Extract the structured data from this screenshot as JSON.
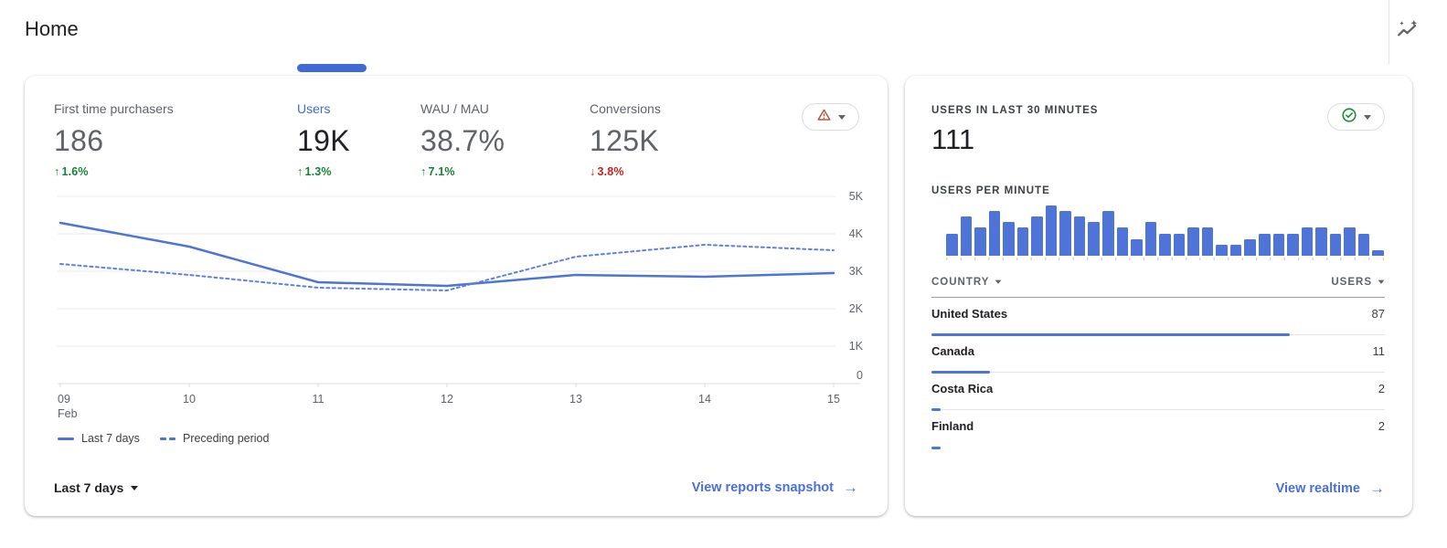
{
  "page": {
    "title": "Home"
  },
  "icons": {
    "arrow_right": "→",
    "arrow_up": "↑",
    "arrow_down": "↓"
  },
  "colors": {
    "chart_blue": "#4f74d8",
    "dashed_blue": "#5e80e0",
    "selected_blue": "#3e6bd6",
    "link_blue": "#4a6fdc",
    "positive_green": "#188038",
    "negative_red": "#c5221f",
    "warning_orange": "#ae5b41",
    "realtime_ok_green": "#1e8e3e"
  },
  "overview_card": {
    "metrics": [
      {
        "label": "First time purchasers",
        "value": "186",
        "delta": "1.6%",
        "direction": "up",
        "selected": false
      },
      {
        "label": "Users",
        "value": "19K",
        "delta": "1.3%",
        "direction": "up",
        "selected": true
      },
      {
        "label": "WAU / MAU",
        "value": "38.7%",
        "delta": "7.1%",
        "direction": "up",
        "selected": false
      },
      {
        "label": "Conversions",
        "value": "125K",
        "delta": "3.8%",
        "direction": "down",
        "selected": false
      }
    ],
    "legend": [
      {
        "label": "Last 7 days",
        "style": "solid"
      },
      {
        "label": "Preceding period",
        "style": "dashed"
      }
    ],
    "date_range_label": "Last 7 days",
    "link_label": "View reports snapshot",
    "chart_data": {
      "type": "line",
      "title": "Users",
      "x": [
        "09 Feb",
        "10",
        "11",
        "12",
        "13",
        "14",
        "15"
      ],
      "series": [
        {
          "name": "Last 7 days",
          "style": "solid",
          "values": [
            4300,
            3650,
            2700,
            2600,
            2900,
            2850,
            2950
          ]
        },
        {
          "name": "Preceding period",
          "style": "dashed",
          "values": [
            3200,
            2900,
            2550,
            2500,
            3400,
            3700,
            3550
          ]
        }
      ],
      "ylim": [
        0,
        5000
      ],
      "yticks": [
        0,
        1000,
        2000,
        3000,
        4000,
        5000
      ],
      "ytick_labels": [
        "0",
        "1K",
        "2K",
        "3K",
        "4K",
        "5K"
      ],
      "grid": true,
      "legend_position": "bottom"
    }
  },
  "realtime_card": {
    "title": "USERS IN LAST 30 MINUTES",
    "value": "111",
    "per_minute_label": "USERS PER MINUTE",
    "chart_data": {
      "type": "bar",
      "title": "USERS PER MINUTE",
      "values": [
        4,
        7,
        5,
        8,
        6,
        5,
        7,
        9,
        8,
        7,
        6,
        8,
        5,
        3,
        6,
        4,
        4,
        5,
        5,
        2,
        2,
        3,
        4,
        4,
        4,
        5,
        5,
        4,
        5,
        4,
        1
      ]
    },
    "table": {
      "columns": [
        "COUNTRY",
        "USERS"
      ],
      "rows": [
        {
          "country": "United States",
          "users": "87",
          "bar_pct": 79
        },
        {
          "country": "Canada",
          "users": "11",
          "bar_pct": 13
        },
        {
          "country": "Costa Rica",
          "users": "2",
          "bar_pct": 2
        },
        {
          "country": "Finland",
          "users": "2",
          "bar_pct": 2
        }
      ]
    },
    "link_label": "View realtime"
  }
}
